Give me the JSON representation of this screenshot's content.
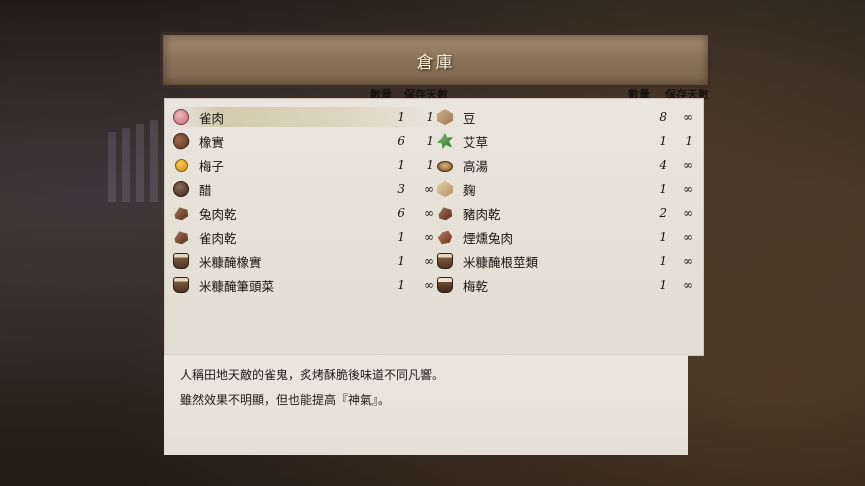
{
  "window": {
    "title": "倉庫"
  },
  "columns": {
    "left": {
      "qty_label": "數量",
      "days_label": "保存天數"
    },
    "right": {
      "qty_label": "數量",
      "days_label": "保存天數"
    }
  },
  "items_left": [
    {
      "name": "雀肉",
      "qty": "1",
      "days": "1",
      "icon": "meat-icon",
      "selected": true
    },
    {
      "name": "橡實",
      "qty": "6",
      "days": "1",
      "icon": "acorn-icon"
    },
    {
      "name": "梅子",
      "qty": "1",
      "days": "1",
      "icon": "plum-icon"
    },
    {
      "name": "醋",
      "qty": "3",
      "days": "∞",
      "icon": "vinegar-icon"
    },
    {
      "name": "兔肉乾",
      "qty": "6",
      "days": "∞",
      "icon": "jerky-icon"
    },
    {
      "name": "雀肉乾",
      "qty": "1",
      "days": "∞",
      "icon": "jerky-icon"
    },
    {
      "name": "米糠醃橡實",
      "qty": "1",
      "days": "∞",
      "icon": "pickle-jar-icon"
    },
    {
      "name": "米糠醃筆頭菜",
      "qty": "1",
      "days": "∞",
      "icon": "pickle-jar-icon"
    }
  ],
  "items_right": [
    {
      "name": "豆",
      "qty": "8",
      "days": "∞",
      "icon": "bean-icon"
    },
    {
      "name": "艾草",
      "qty": "1",
      "days": "1",
      "icon": "herb-icon"
    },
    {
      "name": "高湯",
      "qty": "4",
      "days": "∞",
      "icon": "soup-bowl-icon"
    },
    {
      "name": "麹",
      "qty": "1",
      "days": "∞",
      "icon": "koji-icon"
    },
    {
      "name": "豬肉乾",
      "qty": "2",
      "days": "∞",
      "icon": "jerky-icon"
    },
    {
      "name": "煙燻兔肉",
      "qty": "1",
      "days": "∞",
      "icon": "smoked-meat-icon"
    },
    {
      "name": "米糠醃根莖類",
      "qty": "1",
      "days": "∞",
      "icon": "pickle-jar-icon"
    },
    {
      "name": "梅乾",
      "qty": "1",
      "days": "∞",
      "icon": "pickle-jar-icon"
    }
  ],
  "description": {
    "line1": "人稱田地天敵的雀鬼，炙烤酥脆後味道不同凡響。",
    "line2": "雖然效果不明顯，但也能提高『神氣』。"
  }
}
